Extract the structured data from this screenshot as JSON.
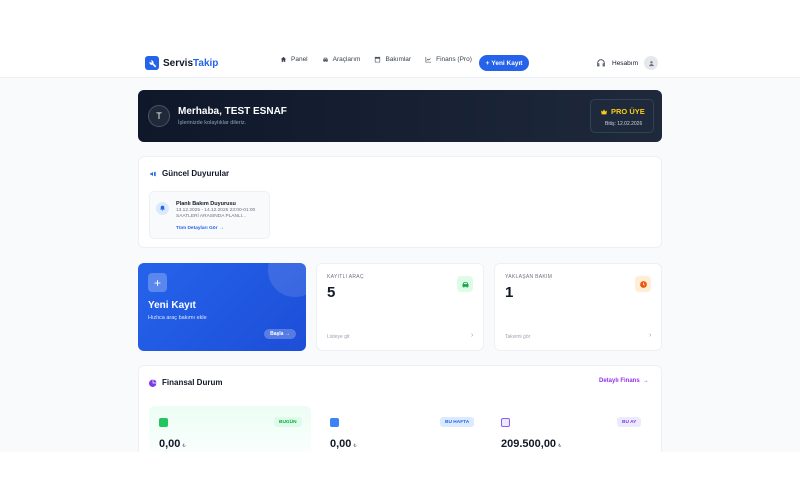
{
  "brand": {
    "name_part1": "Servis",
    "name_part2": "Takip"
  },
  "nav": {
    "items": [
      {
        "label": "Panel",
        "icon": "home-icon"
      },
      {
        "label": "Araçlarım",
        "icon": "car-icon"
      },
      {
        "label": "Bakımlar",
        "icon": "calendar-icon"
      },
      {
        "label": "Finans (Pro)",
        "icon": "chart-line-icon"
      }
    ],
    "new_button": "Yeni Kayıt",
    "account_label": "Hesabım"
  },
  "hero": {
    "initial": "T",
    "greeting": "Merhaba, TEST ESNAF",
    "subtitle": "İşlerinizde kolaylıklar dileriz.",
    "badge_title": "PRO ÜYE",
    "badge_date": "Bitiş: 12.02.2026"
  },
  "announcements": {
    "title": "Güncel Duyurular",
    "items": [
      {
        "title": "Planlı Bakım Duyurusu",
        "body": "13.12.2025 - 14.12.2025 23:00-01:00 SAATLERİ ARASINDA PLANLI...",
        "link": "Tüm Detayları Gör"
      }
    ]
  },
  "new_record_card": {
    "title": "Yeni Kayıt",
    "subtitle": "Hızlıca araç bakımı ekle",
    "button": "Başla"
  },
  "stats": [
    {
      "label": "KAYITLI ARAÇ",
      "value": "5",
      "link": "Listeye git",
      "icon": "car-icon",
      "color": "#16a34a",
      "bg": "#dcfce7"
    },
    {
      "label": "YAKLAŞAN BAKIM",
      "value": "1",
      "link": "Takvimi gör",
      "icon": "clock-icon",
      "color": "#ea580c",
      "bg": "#ffedd5"
    }
  ],
  "finance": {
    "title": "Finansal Durum",
    "detail_link": "Detaylı Finans",
    "boxes": [
      {
        "badge": "BUGÜN",
        "value": "0,00",
        "currency": "₺",
        "badge_color": "#16a34a",
        "badge_bg": "#dcfce7",
        "bg": "#f0fdf4",
        "icon_color": "#22c55e"
      },
      {
        "badge": "BU HAFTA",
        "value": "0,00",
        "currency": "₺",
        "badge_color": "#2563eb",
        "badge_bg": "#dbeafe",
        "bg": "#ffffff",
        "icon_color": "#3b82f6"
      },
      {
        "badge": "BU AY",
        "value": "209.500,00",
        "currency": "₺",
        "badge_color": "#7c3aed",
        "badge_bg": "#ede9fe",
        "bg": "#ffffff",
        "icon_color": "#8b5cf6"
      }
    ]
  }
}
